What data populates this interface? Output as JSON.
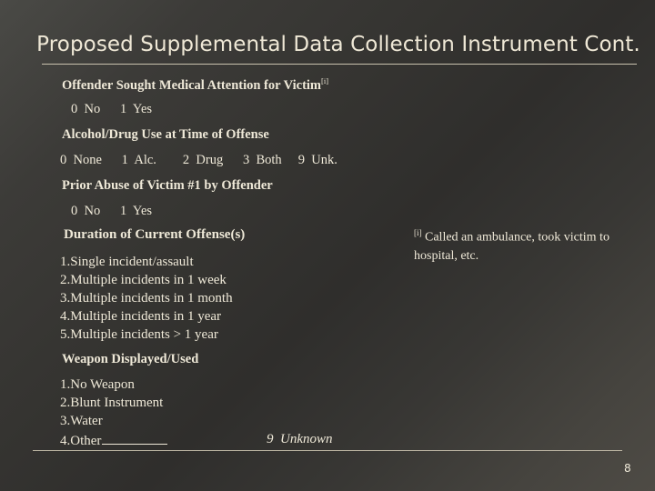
{
  "slide": {
    "title": "Proposed Supplemental Data Collection Instrument Cont.",
    "page_number": "8",
    "sections": [
      {
        "heading": "Offender Sought Medical Attention for Victim",
        "footnote_marker": "[i]",
        "options": "0  No      1  Yes"
      },
      {
        "heading": "Alcohol/Drug Use at Time of Offense",
        "options": "0  None      1  Alc.        2  Drug      3  Both     9  Unk."
      },
      {
        "heading": "Prior Abuse of Victim #1 by Offender",
        "options": "0  No      1  Yes"
      },
      {
        "heading": "Duration of Current Offense(s)",
        "items": [
          "1.Single incident/assault",
          "2.Multiple incidents in 1 week",
          "3.Multiple incidents in 1 month",
          "4.Multiple incidents in 1 year",
          "5.Multiple incidents > 1 year"
        ]
      },
      {
        "heading": "Weapon Displayed/Used",
        "items": [
          "1.No Weapon",
          "2.Blunt Instrument",
          "3.Water",
          "4.Other"
        ],
        "unknown_option": "9  Unknown"
      }
    ],
    "footnote": {
      "marker": "[i]",
      "text": "Called an ambulance, took victim to hospital, etc."
    }
  }
}
